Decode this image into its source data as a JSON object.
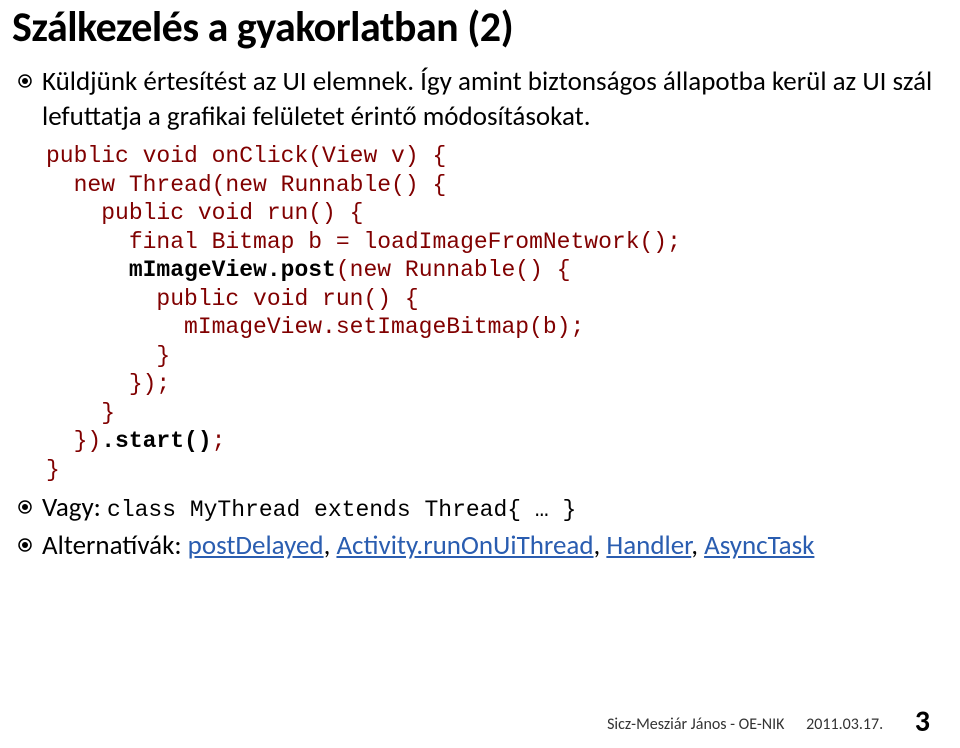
{
  "title": "Szálkezelés a gyakorlatban (2)",
  "b1": "Küldjünk értesítést az UI elemnek. Így amint biztonságos állapotba kerül az UI szál lefuttatja a grafikai felületet érintő módosításokat.",
  "code": {
    "l1": "public void onClick(View v) {",
    "l2": "  new Thread(new Runnable() {",
    "l3": "    public void run() {",
    "l4": "      final Bitmap b = loadImageFromNetwork();",
    "l5a": "      ",
    "l5b": "mImageView.post",
    "l5c": "(new Runnable() {",
    "l6": "        public void run() {",
    "l7": "          mImageView.setImageBitmap(b);",
    "l8": "        }",
    "l9": "      });",
    "l10": "    }",
    "l11a": "  })",
    "l11b": ".start()",
    "l11c": ";",
    "l12": "}"
  },
  "b2a": "Vagy: ",
  "b2b": "class MyThread extends Thread{ … }",
  "b3a": "Alternatívák: ",
  "links": {
    "postDelayed": "postDelayed",
    "sep1": ", ",
    "runOnUiThread": "Activity.runOnUiThread",
    "sep2": ", ",
    "handler": "Handler",
    "sep3": ", ",
    "asyncTask": "AsyncTask"
  },
  "footer": {
    "author": "Sicz-Mesziár János - OE-NIK",
    "date": "2011.03.17.",
    "page": "3"
  }
}
